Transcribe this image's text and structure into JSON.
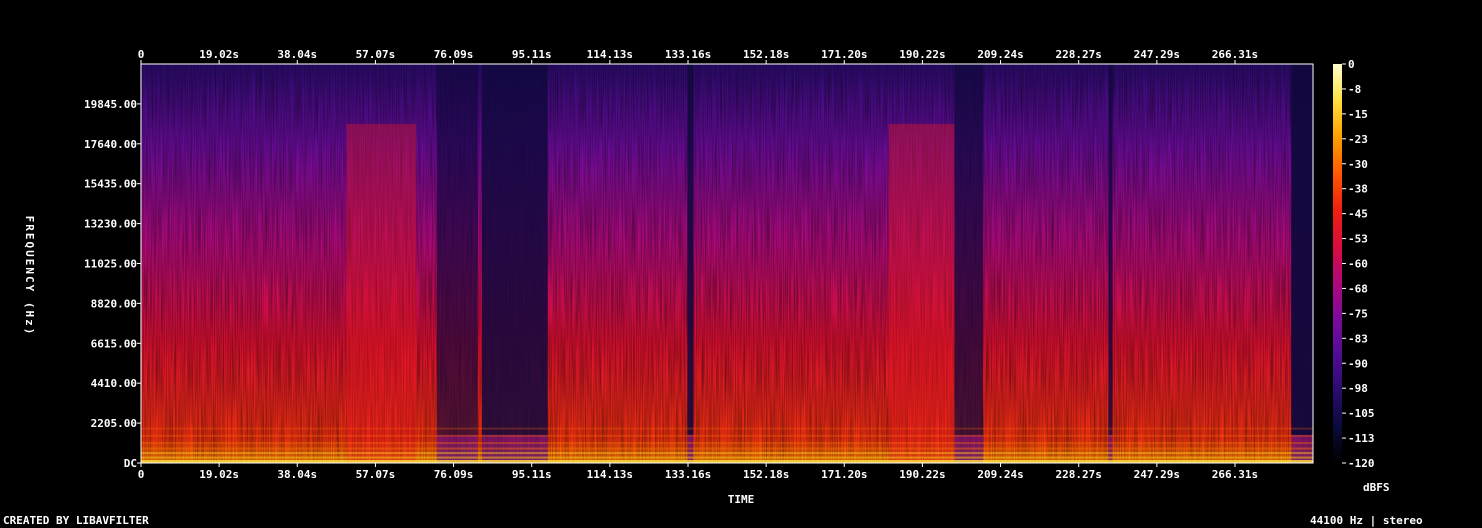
{
  "footer": {
    "created_by": "CREATED BY LIBAVFILTER",
    "format": "44100 Hz | stereo"
  },
  "chart_data": {
    "type": "heatmap",
    "title": "",
    "xlabel": "TIME",
    "ylabel": "FREQUENCY (Hz)",
    "x_ticks": [
      "0",
      "19.02s",
      "38.04s",
      "57.07s",
      "76.09s",
      "95.11s",
      "114.13s",
      "133.16s",
      "152.18s",
      "171.20s",
      "190.22s",
      "209.24s",
      "228.27s",
      "247.29s",
      "266.31s"
    ],
    "x_tick_values": [
      0,
      19.02,
      38.04,
      57.07,
      76.09,
      95.11,
      114.13,
      133.16,
      152.18,
      171.2,
      190.22,
      209.24,
      228.27,
      247.29,
      266.31
    ],
    "xlim": [
      0,
      285.3
    ],
    "y_ticks": [
      "DC",
      "2205.00",
      "4410.00",
      "6615.00",
      "8820.00",
      "11025.00",
      "13230.00",
      "15435.00",
      "17640.00",
      "19845.00"
    ],
    "y_tick_values": [
      0,
      2205,
      4410,
      6615,
      8820,
      11025,
      13230,
      15435,
      17640,
      19845
    ],
    "ylim": [
      0,
      22050
    ],
    "colorbar": {
      "label": "dBFS",
      "ticks": [
        "0",
        "-8",
        "-15",
        "-23",
        "-30",
        "-38",
        "-45",
        "-53",
        "-60",
        "-68",
        "-75",
        "-83",
        "-90",
        "-98",
        "-105",
        "-113",
        "-120"
      ],
      "range": [
        -120,
        0
      ],
      "colors": [
        "#000000",
        "#0a0a3c",
        "#2a0c6e",
        "#520c96",
        "#7e0a9c",
        "#b0087a",
        "#dc0c3c",
        "#f0200f",
        "#ff5a00",
        "#ffa000",
        "#ffe040",
        "#ffffd0"
      ]
    },
    "quiet_segments_s": [
      {
        "start": 72.0,
        "end": 82.0,
        "level": 0.55
      },
      {
        "start": 83.0,
        "end": 99.0,
        "level": 0.25
      },
      {
        "start": 133.0,
        "end": 134.5,
        "level": 0.2
      },
      {
        "start": 198.0,
        "end": 205.0,
        "level": 0.45
      },
      {
        "start": 235.5,
        "end": 236.5,
        "level": 0.3
      },
      {
        "start": 280.0,
        "end": 285.3,
        "level": 0.05
      }
    ],
    "loud_segments_s": [
      {
        "start": 50.0,
        "end": 67.0,
        "level": 0.85
      },
      {
        "start": 182.0,
        "end": 198.0,
        "level": 0.9
      }
    ]
  }
}
